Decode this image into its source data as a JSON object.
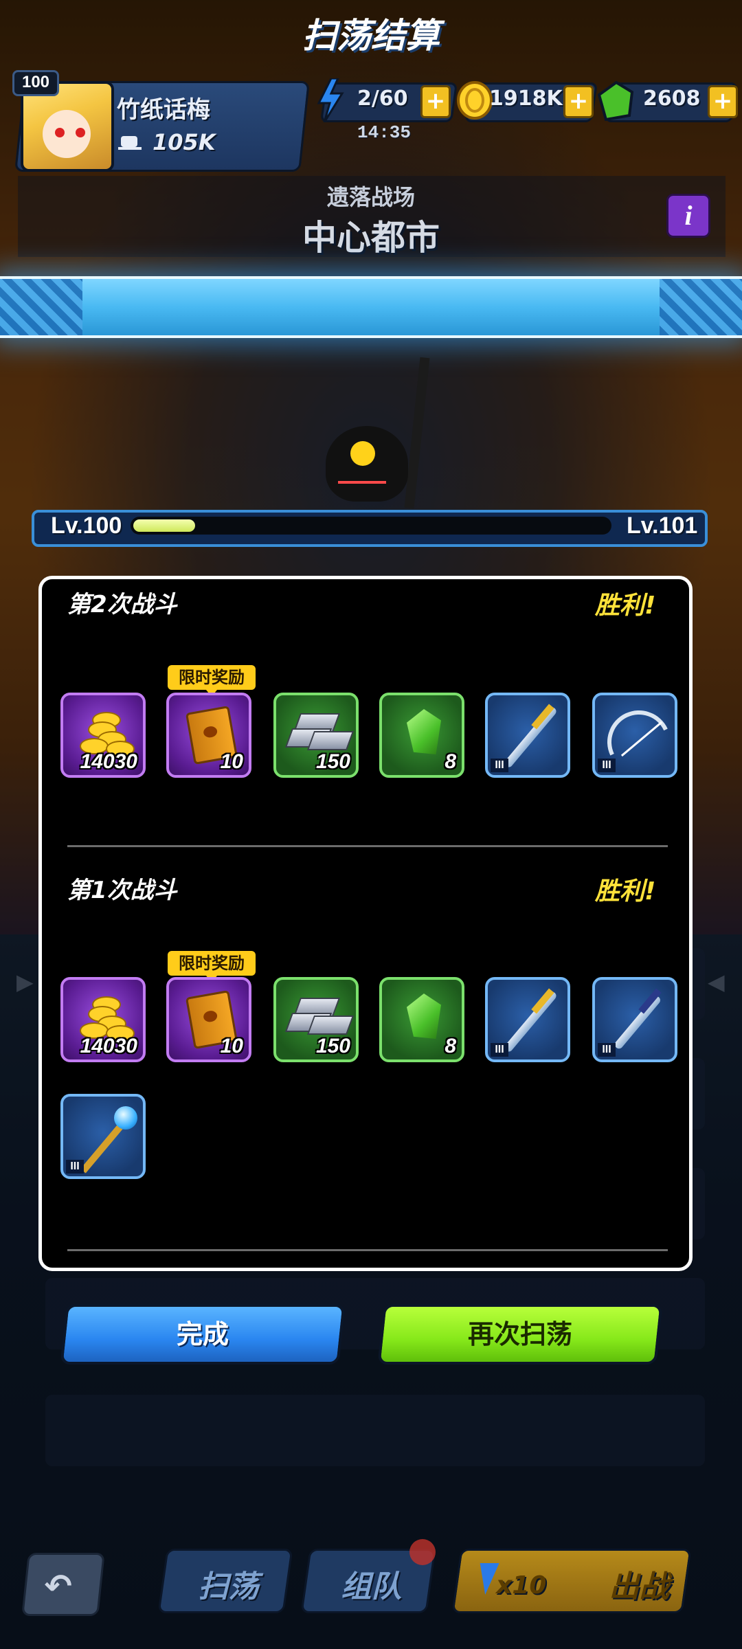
{
  "player": {
    "level": "100",
    "name": "竹纸话梅",
    "power": "105K"
  },
  "resources": {
    "energy": "2/60",
    "energy_timer": "14:35",
    "gold": "1918K",
    "gems": "2608",
    "plus": "+"
  },
  "location": {
    "subtitle": "遗落战场",
    "title": "中心都市",
    "info": "i"
  },
  "banner": {
    "title": "扫荡结算"
  },
  "xp": {
    "current_level": "Lv.100",
    "next_level": "Lv.101",
    "progress": 0.13
  },
  "battles": [
    {
      "title": "第2次战斗",
      "result": "胜利!",
      "limited_tag": "限时奖励",
      "rewards": [
        {
          "item": "gold-coins",
          "qty": "14030",
          "rarity": "purple"
        },
        {
          "item": "skill-book",
          "qty": "10",
          "rarity": "purple"
        },
        {
          "item": "iron-ingot",
          "qty": "150",
          "rarity": "green"
        },
        {
          "item": "green-gem",
          "qty": "8",
          "rarity": "green"
        },
        {
          "item": "sword",
          "tier": "III",
          "rarity": "blue"
        },
        {
          "item": "crossbow",
          "tier": "III",
          "rarity": "blue"
        }
      ]
    },
    {
      "title": "第1次战斗",
      "result": "胜利!",
      "limited_tag": "限时奖励",
      "rewards": [
        {
          "item": "gold-coins",
          "qty": "14030",
          "rarity": "purple"
        },
        {
          "item": "skill-book",
          "qty": "10",
          "rarity": "purple"
        },
        {
          "item": "iron-ingot",
          "qty": "150",
          "rarity": "green"
        },
        {
          "item": "green-gem",
          "qty": "8",
          "rarity": "green"
        },
        {
          "item": "sword",
          "tier": "III",
          "rarity": "blue"
        },
        {
          "item": "dagger",
          "tier": "III",
          "rarity": "blue"
        },
        {
          "item": "staff",
          "tier": "III",
          "rarity": "blue"
        }
      ]
    }
  ],
  "buttons": {
    "done": "完成",
    "sweep_again": "再次扫荡"
  },
  "bottom_nav": {
    "sweep": "扫荡",
    "team": "组队",
    "energy_multiplier": "x10",
    "fight": "出战"
  },
  "colors": {
    "victory": "#ffe23a",
    "done_button": "#2a86f0",
    "sweep_again_button": "#86e81a",
    "banner": "#49b9f2"
  }
}
